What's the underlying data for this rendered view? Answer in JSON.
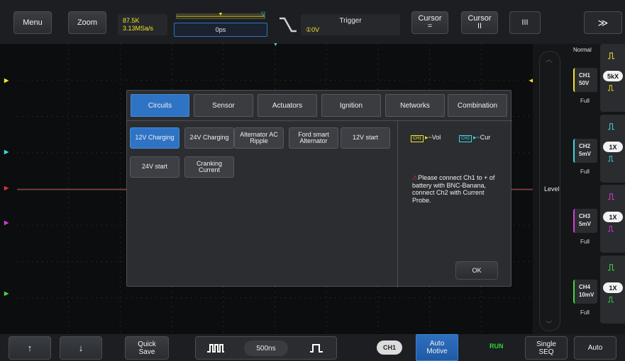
{
  "topbar": {
    "menu": "Menu",
    "zoom": "Zoom",
    "sample_rate": "87.5K",
    "sample_speed": "3.13MSa/s",
    "time_offset": "0ps",
    "trigger_title": "Trigger",
    "trigger_value": "①0V",
    "cursor_h": "Cursor",
    "cursor_h_sym": "=",
    "cursor_v": "Cursor",
    "cursor_v_sym": "II",
    "cursor_bars": "III",
    "collapse": "≫"
  },
  "right_panel": {
    "mode": "Normal",
    "level": "Level",
    "channels": [
      {
        "name": "CH1",
        "volt": "50V",
        "range": "Full",
        "probe": "5kX",
        "color": "#f1e32c"
      },
      {
        "name": "CH2",
        "volt": "5mV",
        "range": "Full",
        "probe": "1X",
        "color": "#3fd6e0"
      },
      {
        "name": "CH3",
        "volt": "5mV",
        "range": "Full",
        "probe": "1X",
        "color": "#d93ad9"
      },
      {
        "name": "CH4",
        "volt": "10mV",
        "range": "Full",
        "probe": "1X",
        "color": "#3fd93f"
      }
    ]
  },
  "dialog": {
    "tabs": [
      "Circuits",
      "Sensor",
      "Actuators",
      "Ignition",
      "Networks",
      "Combination"
    ],
    "options": [
      "12V Charging",
      "24V Charging",
      "Alternator AC Ripple",
      "Ford smart Alternator",
      "12V start",
      "24V start",
      "Cranking Current"
    ],
    "ch1_tag": "CH1",
    "ch1_label": "Vol",
    "ch2_tag": "CH2",
    "ch2_label": "Cur",
    "instruction": "Please connect Ch1 to + of battery with BNC-Banana, connect Ch2 with Current Probe.",
    "ok": "OK"
  },
  "bottombar": {
    "up": "↑",
    "down": "↓",
    "quick_save": "Quick Save",
    "timebase": "500ns",
    "ch_select": "CH1",
    "auto_motive": "Auto Motive",
    "run": "RUN",
    "single_seq": "Single SEQ",
    "auto": "Auto"
  },
  "colors": {
    "accent": "#2f73c4",
    "run": "#2fd62f",
    "trigger_marker": "#f1e32c"
  }
}
